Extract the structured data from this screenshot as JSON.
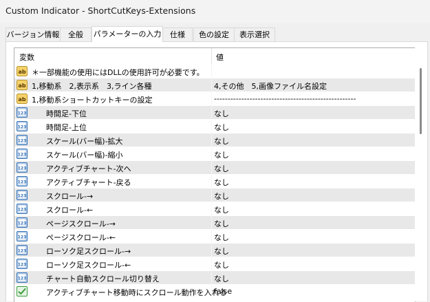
{
  "window": {
    "title": "Custom Indicator - ShortCutKeys-Extensions"
  },
  "tabs": [
    {
      "label": "バージョン情報",
      "active": false
    },
    {
      "label": "全般",
      "active": false
    },
    {
      "label": "パラメーターの入力",
      "active": true
    },
    {
      "label": "仕様",
      "active": false
    },
    {
      "label": "色の設定",
      "active": false
    },
    {
      "label": "表示選択",
      "active": false
    }
  ],
  "table": {
    "headers": {
      "variable": "変数",
      "value": "値"
    },
    "rows": [
      {
        "icon": "string-ab-icon",
        "name": "＊一部機能の使用にはDLLの使用許可が必要です。",
        "value": "",
        "indent": false
      },
      {
        "icon": "string-ab-icon",
        "name": "1,移動系　2,表示系　3,ライン各種",
        "value": "4,その他　5,画像ファイル名設定",
        "indent": false
      },
      {
        "icon": "string-ab-icon",
        "name": "1,移動系ショートカットキーの設定",
        "value": "----------------------------------------------------",
        "indent": false
      },
      {
        "icon": "enum-123-icon",
        "name": "時間足-下位",
        "value": "なし",
        "indent": true
      },
      {
        "icon": "enum-123-icon",
        "name": "時間足-上位",
        "value": "なし",
        "indent": true
      },
      {
        "icon": "enum-123-icon",
        "name": "スケール(バー幅)-拡大",
        "value": "なし",
        "indent": true
      },
      {
        "icon": "enum-123-icon",
        "name": "スケール(バー幅)-縮小",
        "value": "なし",
        "indent": true
      },
      {
        "icon": "enum-123-icon",
        "name": "アクティブチャート-次へ",
        "value": "なし",
        "indent": true
      },
      {
        "icon": "enum-123-icon",
        "name": "アクティブチャート-戻る",
        "value": "なし",
        "indent": true
      },
      {
        "icon": "enum-123-icon",
        "name": "スクロール-→",
        "value": "なし",
        "indent": true
      },
      {
        "icon": "enum-123-icon",
        "name": "スクロール-←",
        "value": "なし",
        "indent": true
      },
      {
        "icon": "enum-123-icon",
        "name": "ページスクロール-→",
        "value": "なし",
        "indent": true
      },
      {
        "icon": "enum-123-icon",
        "name": "ページスクロール-←",
        "value": "なし",
        "indent": true
      },
      {
        "icon": "enum-123-icon",
        "name": "ローソク足スクロール-→",
        "value": "なし",
        "indent": true
      },
      {
        "icon": "enum-123-icon",
        "name": "ローソク足スクロール-←",
        "value": "なし",
        "indent": true
      },
      {
        "icon": "enum-123-icon",
        "name": "チャート自動スクロール切り替え",
        "value": "なし",
        "indent": true
      },
      {
        "icon": "bool-icon",
        "name": "アクティブチャート移動時にスクロール動作を入れる",
        "value": "false",
        "indent": true
      }
    ]
  },
  "colors": {
    "row_even": "#e8e8e8",
    "string_icon": "#f5d26a",
    "enum_icon": "#2f6fb5",
    "bool_icon": "#3a9a3a"
  }
}
